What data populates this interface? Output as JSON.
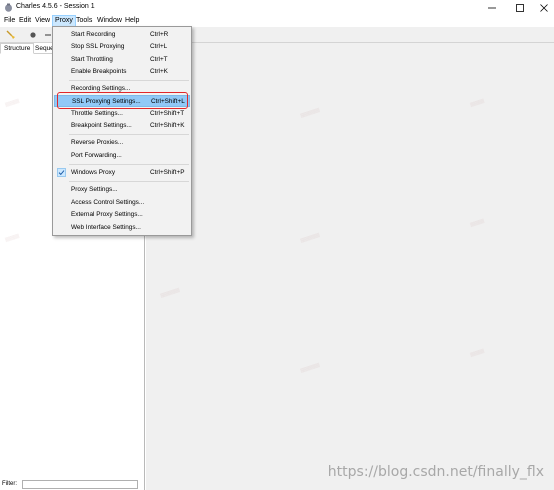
{
  "window": {
    "title": "Charles 4.5.6 - Session 1"
  },
  "menubar": {
    "items": [
      "File",
      "Edit",
      "View",
      "Proxy",
      "Tools",
      "Window",
      "Help"
    ]
  },
  "tabs": {
    "structure": "Structure",
    "sequence": "Seque"
  },
  "filter": {
    "label": "Filter:"
  },
  "proxy_menu": {
    "start_recording": {
      "label": "Start Recording",
      "shortcut": "Ctrl+R"
    },
    "stop_ssl": {
      "label": "Stop SSL Proxying",
      "shortcut": "Ctrl+L"
    },
    "start_throttling": {
      "label": "Start Throttling",
      "shortcut": "Ctrl+T"
    },
    "enable_breakpoints": {
      "label": "Enable Breakpoints",
      "shortcut": "Ctrl+K"
    },
    "recording_settings": {
      "label": "Recording Settings..."
    },
    "ssl_settings": {
      "label": "SSL Proxying Settings...",
      "shortcut": "Ctrl+Shift+L"
    },
    "throttle_settings": {
      "label": "Throttle Settings...",
      "shortcut": "Ctrl+Shift+T"
    },
    "breakpoint_settings": {
      "label": "Breakpoint Settings...",
      "shortcut": "Ctrl+Shift+K"
    },
    "reverse_proxies": {
      "label": "Reverse Proxies..."
    },
    "port_forwarding": {
      "label": "Port Forwarding..."
    },
    "windows_proxy": {
      "label": "Windows Proxy",
      "shortcut": "Ctrl+Shift+P",
      "checked": true
    },
    "proxy_settings": {
      "label": "Proxy Settings..."
    },
    "access_control": {
      "label": "Access Control Settings..."
    },
    "external_proxy": {
      "label": "External Proxy Settings..."
    },
    "web_interface": {
      "label": "Web Interface Settings..."
    }
  },
  "watermark": "https://blog.csdn.net/finally_flx",
  "icons": {
    "app": "charles-jug-icon",
    "minimize": "minimize-icon",
    "maximize": "maximize-icon",
    "close": "close-icon",
    "broom": "broom-icon",
    "record": "record-icon",
    "check": "check-icon"
  },
  "colors": {
    "highlight": "#91c9f7",
    "annotation": "#e0282c",
    "menu_active": "#cce8ff"
  }
}
